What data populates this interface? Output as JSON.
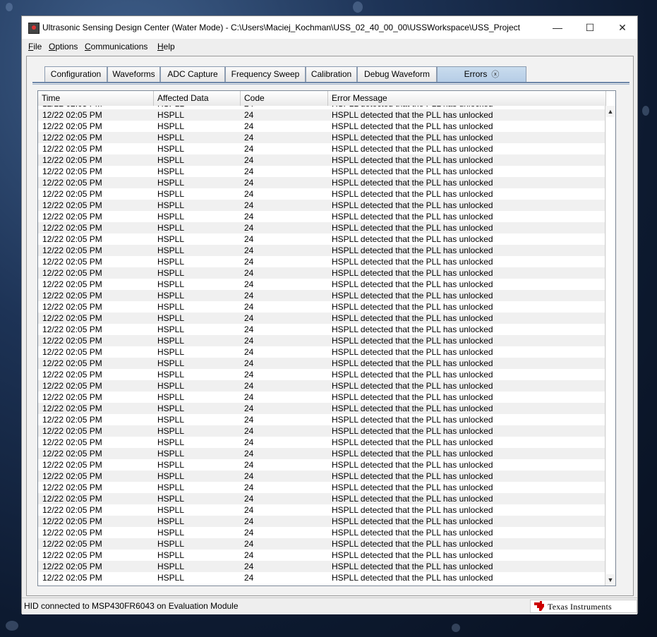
{
  "window": {
    "title": "Ultrasonic Sensing Design Center (Water Mode) - C:\\Users\\Maciej_Kochman\\USS_02_40_00_00\\USSWorkspace\\USS_Project",
    "minimize_glyph": "—",
    "maximize_glyph": "☐",
    "close_glyph": "✕"
  },
  "menu": [
    {
      "key": "F",
      "rest": "ile"
    },
    {
      "key": "O",
      "rest": "ptions"
    },
    {
      "key": "C",
      "rest": "ommunications"
    },
    {
      "key": "H",
      "rest": "elp"
    }
  ],
  "tabs": [
    {
      "label": "Configuration"
    },
    {
      "label": "Waveforms"
    },
    {
      "label": "ADC Capture"
    },
    {
      "label": "Frequency Sweep"
    },
    {
      "label": "Calibration"
    },
    {
      "label": "Debug Waveform"
    },
    {
      "label": "Errors",
      "active": true,
      "close_glyph": "ⓧ"
    }
  ],
  "table": {
    "columns": [
      "Time",
      "Affected Data",
      "Code",
      "Error Message"
    ],
    "row": {
      "time": "12/22 02:05 PM",
      "affected_data": "HSPLL",
      "code": "24",
      "message": "HSPLL detected that the PLL has unlocked"
    },
    "visible_row_count": 43,
    "scroll_up_glyph": "▲",
    "scroll_down_glyph": "▼"
  },
  "status": {
    "text": "HID connected to MSP430FR6043 on Evaluation Module"
  },
  "logo": {
    "text": "Texas Instruments",
    "icon": "ti-logo-icon",
    "color": "#cc0000"
  }
}
